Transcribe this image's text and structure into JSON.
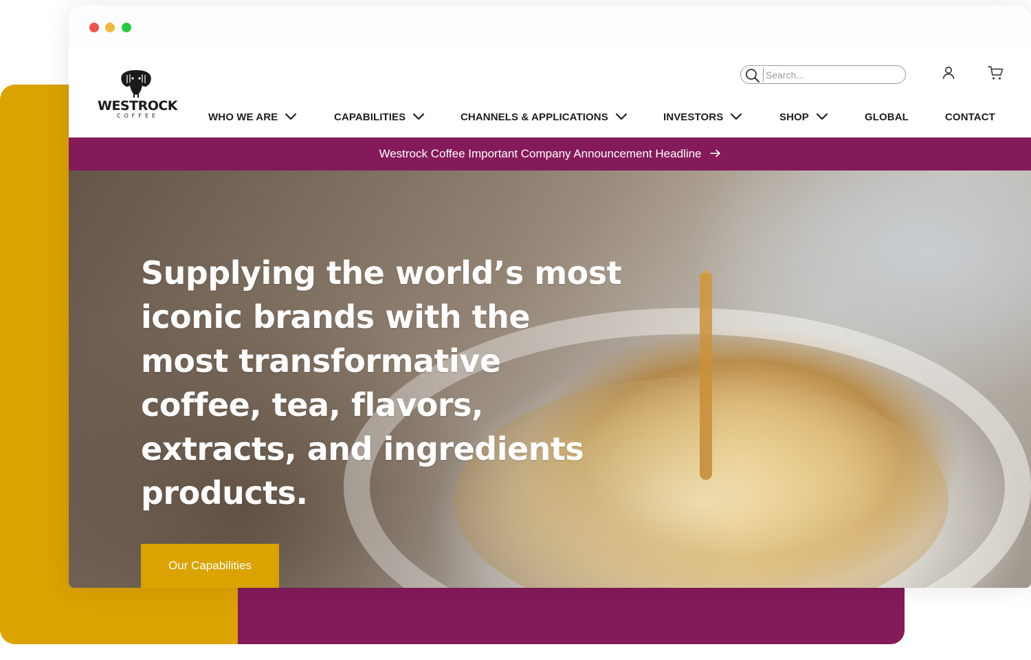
{
  "browser": {
    "dots": [
      "red",
      "yellow",
      "green"
    ]
  },
  "brand": {
    "name": "WESTROCK",
    "tagline": "COFFEE",
    "logo_icon": "elephant-head-icon"
  },
  "search": {
    "placeholder": "Search...",
    "value": "",
    "icon": "search-icon"
  },
  "utility": {
    "account_icon": "user-icon",
    "cart_icon": "cart-icon"
  },
  "nav": {
    "items": [
      {
        "label": "WHO WE ARE",
        "dropdown": true
      },
      {
        "label": "CAPABILITIES",
        "dropdown": true
      },
      {
        "label": "CHANNELS & APPLICATIONS",
        "dropdown": true
      },
      {
        "label": "INVESTORS",
        "dropdown": true
      },
      {
        "label": "SHOP",
        "dropdown": true
      },
      {
        "label": "GLOBAL",
        "dropdown": false
      },
      {
        "label": "CONTACT",
        "dropdown": false
      }
    ]
  },
  "announcement": {
    "text": "Westrock Coffee Important Company Announcement Headline",
    "icon": "arrow-right-icon"
  },
  "hero": {
    "title": "Supplying the world’s most iconic brands with the most transformative coffee, tea, flavors, extracts, and ingredients products.",
    "cta_label": "Our Capabilities"
  },
  "colors": {
    "gold": "#dba300",
    "plum": "#841a5a",
    "text_dark": "#1e1e1e",
    "white": "#ffffff"
  }
}
